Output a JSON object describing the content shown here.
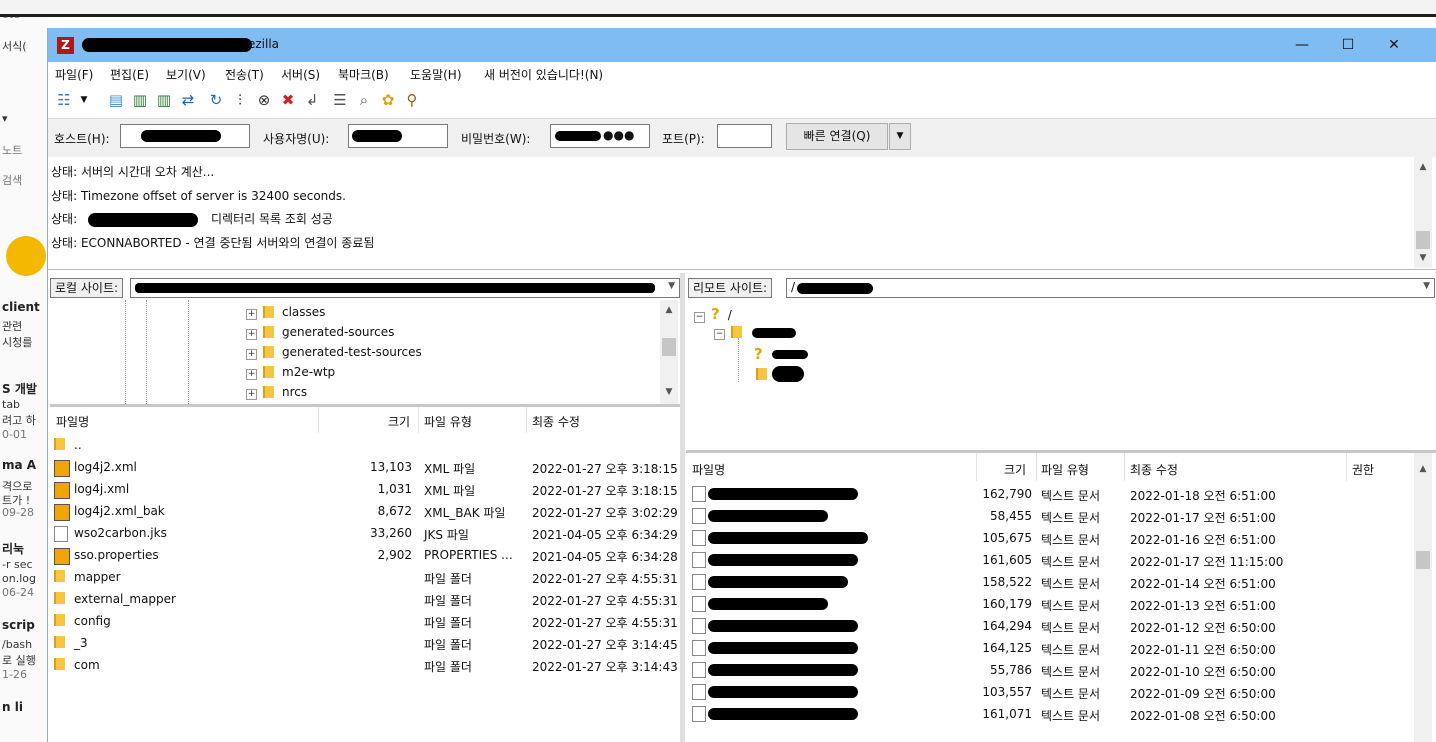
{
  "background_app": {
    "lines": [
      "ote",
      "서식(",
      "▾",
      "노트",
      "검색",
      "client",
      "관련",
      "시청를",
      "S 개발",
      "tab",
      "려고 하",
      "0-01",
      "ma A",
      "격으로",
      "트가 !",
      "09-28",
      "리눅",
      "-r sec",
      "on.log",
      "06-24",
      "scrip",
      "/bash",
      "로 실행",
      "1-26",
      "n li"
    ]
  },
  "window": {
    "title_suffix": "ezilla",
    "controls": {
      "minimize": "—",
      "maximize": "☐",
      "close": "✕"
    }
  },
  "menu": [
    "파일(F)",
    "편집(E)",
    "보기(V)",
    "전송(T)",
    "서버(S)",
    "북마크(B)",
    "도움말(H)",
    "새 버전이 있습니다!(N)"
  ],
  "toolbar": {
    "icons": [
      "site-manager-icon",
      "dropdown-arrow-icon",
      "message-log-icon",
      "local-tree-icon",
      "remote-tree-icon",
      "transfer-queue-icon",
      "refresh-icon",
      "process-queue-icon",
      "cancel-icon",
      "disconnect-icon",
      "reconnect-icon",
      "filter-icon",
      "compare-icon",
      "sync-browse-icon",
      "search-icon"
    ]
  },
  "quickconnect": {
    "host_label": "호스트(H):",
    "user_label": "사용자명(U):",
    "pass_label": "비밀번호(W):",
    "pass_dots": "●●●",
    "port_label": "포트(P):",
    "port_value": "",
    "button": "빠른 연결(Q)"
  },
  "log": [
    "상태:  서버의 시간대 오차 계산...",
    "상태:  Timezone offset of server is 32400 seconds.",
    "상태:  ",
    "상태:  ECONNABORTED - 연결 중단됨 서버와의 연결이 종료됨"
  ],
  "log_line3_suffix": "디렉터리 목록 조회 성공",
  "local": {
    "label": "로컬 사이트:",
    "tree": [
      "classes",
      "generated-sources",
      "generated-test-sources",
      "m2e-wtp",
      "nrcs"
    ],
    "headers": {
      "name": "파일명",
      "size": "크기",
      "type": "파일 유형",
      "modified": "최종 수정"
    },
    "files": [
      {
        "name": "..",
        "size": "",
        "type": "",
        "modified": "",
        "icon": "folder"
      },
      {
        "name": "log4j2.xml",
        "size": "13,103",
        "type": "XML 파일",
        "modified": "2022-01-27 오후 3:18:15",
        "icon": "xml"
      },
      {
        "name": "log4j.xml",
        "size": "1,031",
        "type": "XML 파일",
        "modified": "2022-01-27 오후 3:18:15",
        "icon": "xml"
      },
      {
        "name": "log4j2.xml_bak",
        "size": "8,672",
        "type": "XML_BAK 파일",
        "modified": "2022-01-27 오후 3:02:29",
        "icon": "xml"
      },
      {
        "name": "wso2carbon.jks",
        "size": "33,260",
        "type": "JKS 파일",
        "modified": "2021-04-05 오후 6:34:29",
        "icon": "file"
      },
      {
        "name": "sso.properties",
        "size": "2,902",
        "type": "PROPERTIES ...",
        "modified": "2021-04-05 오후 6:34:28",
        "icon": "xml"
      },
      {
        "name": "mapper",
        "size": "",
        "type": "파일 폴더",
        "modified": "2022-01-27 오후 4:55:31",
        "icon": "folder"
      },
      {
        "name": "external_mapper",
        "size": "",
        "type": "파일 폴더",
        "modified": "2022-01-27 오후 4:55:31",
        "icon": "folder"
      },
      {
        "name": "config",
        "size": "",
        "type": "파일 폴더",
        "modified": "2022-01-27 오후 4:55:31",
        "icon": "folder"
      },
      {
        "name": "_3",
        "size": "",
        "type": "파일 폴더",
        "modified": "2022-01-27 오후 3:14:45",
        "icon": "folder"
      },
      {
        "name": "com",
        "size": "",
        "type": "파일 폴더",
        "modified": "2022-01-27 오후 3:14:43",
        "icon": "folder"
      }
    ]
  },
  "remote": {
    "label": "리모트 사이트:",
    "path": "/",
    "tree_root": "/",
    "headers": {
      "name": "파일명",
      "size": "크기",
      "type": "파일 유형",
      "modified": "최종 수정",
      "perm": "권한"
    },
    "files": [
      {
        "size": "162,790",
        "type": "텍스트 문서",
        "modified": "2022-01-18 오전 6:51:00"
      },
      {
        "size": "58,455",
        "type": "텍스트 문서",
        "modified": "2022-01-17 오전 6:51:00"
      },
      {
        "size": "105,675",
        "type": "텍스트 문서",
        "modified": "2022-01-16 오전 6:51:00"
      },
      {
        "size": "161,605",
        "type": "텍스트 문서",
        "modified": "2022-01-17 오전 11:15:00"
      },
      {
        "size": "158,522",
        "type": "텍스트 문서",
        "modified": "2022-01-14 오전 6:51:00"
      },
      {
        "size": "160,179",
        "type": "텍스트 문서",
        "modified": "2022-01-13 오전 6:51:00"
      },
      {
        "size": "164,294",
        "type": "텍스트 문서",
        "modified": "2022-01-12 오전 6:50:00"
      },
      {
        "size": "164,125",
        "type": "텍스트 문서",
        "modified": "2022-01-11 오전 6:50:00"
      },
      {
        "size": "55,786",
        "type": "텍스트 문서",
        "modified": "2022-01-10 오전 6:50:00"
      },
      {
        "size": "103,557",
        "type": "텍스트 문서",
        "modified": "2022-01-09 오전 6:50:00"
      },
      {
        "size": "161,071",
        "type": "텍스트 문서",
        "modified": "2022-01-08 오전 6:50:00"
      }
    ]
  }
}
